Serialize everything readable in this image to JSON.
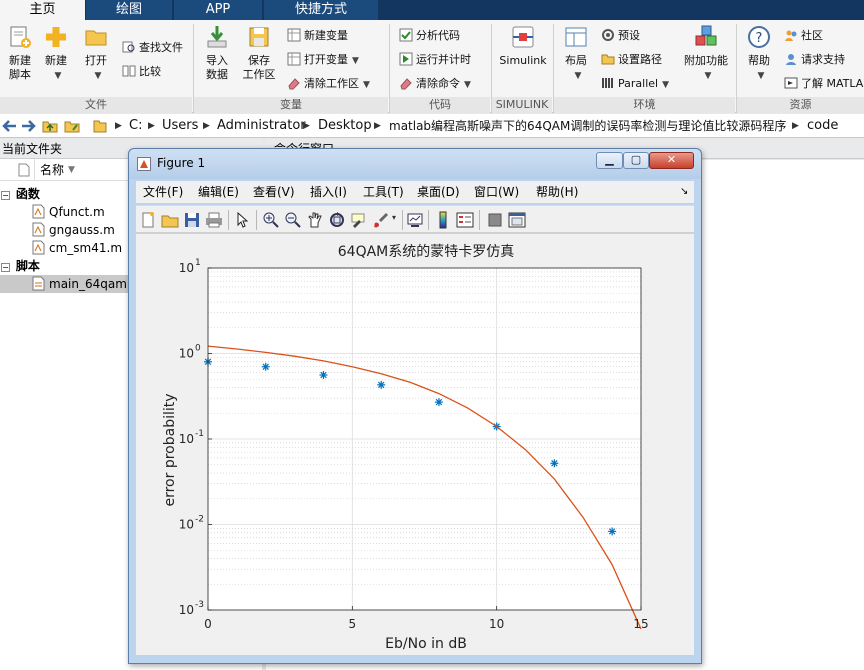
{
  "tabs": [
    "主页",
    "绘图",
    "APP",
    "快捷方式"
  ],
  "ribbon": {
    "file": {
      "label": "文件",
      "new_script": "新建\n脚本",
      "new": "新建",
      "open": "打开",
      "find_files": "查找文件",
      "compare": "比较"
    },
    "variable": {
      "label": "变量",
      "import_data": "导入\n数据",
      "save_workspace": "保存\n工作区",
      "new_variable": "新建变量",
      "open_variable": "打开变量",
      "clear_workspace": "清除工作区"
    },
    "code": {
      "label": "代码",
      "analyze_code": "分析代码",
      "run_and_time": "运行并计时",
      "clear_commands": "清除命令"
    },
    "simulink": {
      "label": "SIMULINK",
      "button": "Simulink"
    },
    "environment": {
      "label": "环境",
      "layout": "布局",
      "preferences": "预设",
      "set_path": "设置路径",
      "parallel": "Parallel",
      "addons": "附加功能"
    },
    "resources": {
      "label": "资源",
      "help": "帮助",
      "community": "社区",
      "request_support": "请求支持",
      "learn_matlab": "了解 MATLA"
    }
  },
  "address": {
    "crumbs": [
      "C:",
      "Users",
      "Administrator",
      "Desktop",
      "matlab编程高斯噪声下的64QAM调制的误码率检测与理论值比较源码程序",
      "code"
    ]
  },
  "current_folder": {
    "title": "当前文件夹",
    "name_col": "名称",
    "group_functions": "函数",
    "functions": [
      "Qfunct.m",
      "gngauss.m",
      "cm_sm41.m"
    ],
    "group_scripts": "脚本",
    "scripts": [
      "main_64qam.m"
    ]
  },
  "command_window": {
    "title": "命令行窗口"
  },
  "figure": {
    "title": "Figure 1",
    "menu": [
      "文件(F)",
      "编辑(E)",
      "查看(V)",
      "插入(I)",
      "工具(T)",
      "桌面(D)",
      "窗口(W)",
      "帮助(H)"
    ],
    "toolbar_icons": [
      "new-figure-icon",
      "open-file-icon",
      "save-icon",
      "print-icon",
      "pointer-icon",
      "zoom-in-icon",
      "zoom-out-icon",
      "pan-icon",
      "rotate-icon",
      "data-cursor-icon",
      "brush-icon",
      "link-plot-icon",
      "colorbar-icon",
      "legend-icon",
      "hide-tools-icon",
      "show-tools-icon"
    ]
  },
  "chart_data": {
    "type": "scatter",
    "title": "64QAM系统的蒙特卡罗仿真",
    "xlabel": "Eb/No in dB",
    "ylabel": "error probability",
    "xlim": [
      0,
      15
    ],
    "ylim": [
      0.001,
      10
    ],
    "yscale": "log",
    "xticks": [
      0,
      5,
      10,
      15
    ],
    "yticks": [
      0.001,
      0.01,
      0.1,
      1,
      10
    ],
    "ytick_exponents": [
      "-3",
      "-2",
      "-1",
      "0",
      "1"
    ],
    "grid": true,
    "series": [
      {
        "type": "scatter",
        "marker": "*",
        "color": "#0072bd",
        "x": [
          0,
          2,
          4,
          6,
          8,
          10,
          12,
          14
        ],
        "y": [
          0.8,
          0.7,
          0.56,
          0.43,
          0.27,
          0.14,
          0.052,
          0.0083
        ]
      },
      {
        "type": "line",
        "color": "#d95319",
        "x": [
          0,
          1,
          2,
          3,
          4,
          5,
          6,
          7,
          8,
          9,
          10,
          11,
          12,
          13,
          14,
          15
        ],
        "y": [
          1.22,
          1.13,
          1.03,
          0.93,
          0.82,
          0.7,
          0.58,
          0.46,
          0.34,
          0.23,
          0.14,
          0.075,
          0.034,
          0.012,
          0.0034,
          0.0006
        ]
      }
    ]
  }
}
